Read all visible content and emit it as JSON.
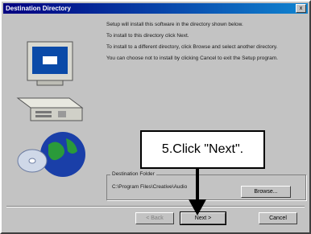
{
  "window": {
    "title": "Destination Directory"
  },
  "instructions": {
    "line1": "Setup will install this software in the directory shown below.",
    "line2": "To install to this directory click Next.",
    "line3": "To install to a different directory, click Browse and select another directory.",
    "line4": "You can choose not to install by clicking Cancel to exit the Setup program."
  },
  "destination": {
    "label": "Destination Folder",
    "path": "C:\\Program Files\\Creative\\Audio"
  },
  "buttons": {
    "browse": "Browse...",
    "back": "< Back",
    "next": "Next >",
    "cancel": "Cancel",
    "close": "x"
  },
  "callout": {
    "text": "5.Click \"Next\"."
  }
}
